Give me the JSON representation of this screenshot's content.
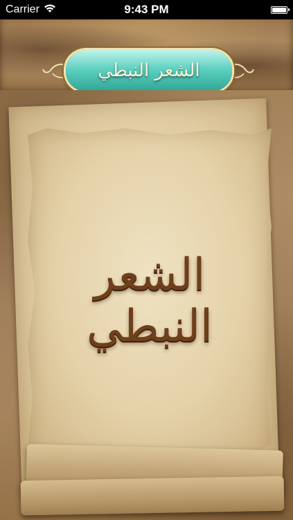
{
  "status_bar": {
    "carrier": "Carrier",
    "time": "9:43 PM",
    "wifi_icon": "wifi-icon",
    "battery_icon": "battery-icon",
    "battery_level": 1.0
  },
  "header": {
    "logo_text": "الشعر النبطي"
  },
  "main": {
    "title": "الشعر النبطي"
  },
  "colors": {
    "plaque": "#5fd1c2",
    "title": "#6e3f1a",
    "parchment": "#e4d1a8",
    "wood": "#9a774d"
  }
}
